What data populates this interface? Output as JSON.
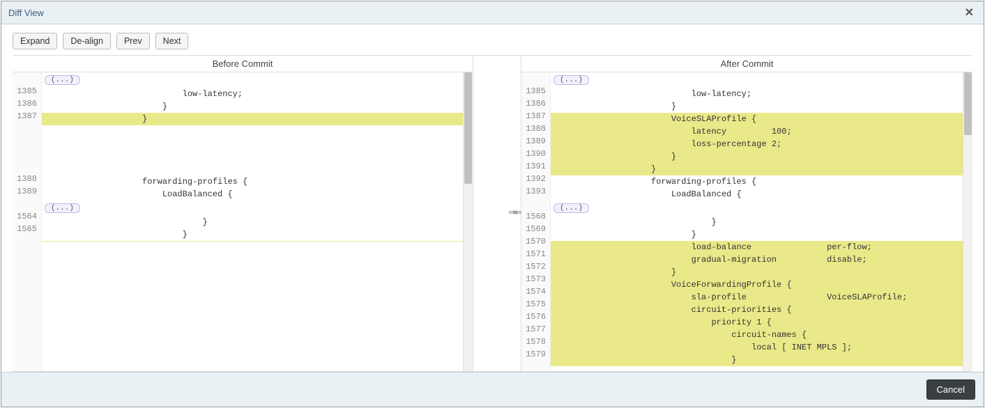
{
  "dialog": {
    "title": "Diff View",
    "close_label": "✕"
  },
  "toolbar": {
    "expand": "Expand",
    "dealign": "De-align",
    "prev": "Prev",
    "next": "Next"
  },
  "headers": {
    "before": "Before Commit",
    "after": "After Commit"
  },
  "fold_label": "(...)",
  "center": {
    "arrows": "⇒⇐"
  },
  "left": {
    "rows": [
      {
        "type": "fold"
      },
      {
        "ln": "1385",
        "text": "                            low-latency;"
      },
      {
        "ln": "1386",
        "text": "                        }"
      },
      {
        "ln": "1387",
        "text": "                    }",
        "class": "hl"
      },
      {
        "ln": "",
        "text": ""
      },
      {
        "ln": "",
        "text": ""
      },
      {
        "ln": "",
        "text": ""
      },
      {
        "ln": "",
        "text": ""
      },
      {
        "ln": "1388",
        "text": "                    forwarding-profiles {"
      },
      {
        "ln": "1389",
        "text": "                        LoadBalanced {"
      },
      {
        "type": "fold"
      },
      {
        "ln": "1564",
        "text": "                                }"
      },
      {
        "ln": "1565",
        "text": "                            }"
      },
      {
        "type": "sep"
      }
    ]
  },
  "right": {
    "rows": [
      {
        "type": "fold"
      },
      {
        "ln": "1385",
        "text": "                            low-latency;"
      },
      {
        "ln": "1386",
        "text": "                        }"
      },
      {
        "ln": "1387",
        "text": "                        VoiceSLAProfile {",
        "class": "hl"
      },
      {
        "ln": "1388",
        "text": "                            latency         100;",
        "class": "hl"
      },
      {
        "ln": "1389",
        "text": "                            loss-percentage 2;",
        "class": "hl"
      },
      {
        "ln": "1390",
        "text": "                        }",
        "class": "hl"
      },
      {
        "ln": "1391",
        "text": "                    }",
        "class": "hl"
      },
      {
        "ln": "1392",
        "text": "                    forwarding-profiles {"
      },
      {
        "ln": "1393",
        "text": "                        LoadBalanced {"
      },
      {
        "type": "fold"
      },
      {
        "ln": "1568",
        "text": "                                }"
      },
      {
        "ln": "1569",
        "text": "                            }"
      },
      {
        "ln": "1570",
        "text": "                            load-balance               per-flow;",
        "class": "hl"
      },
      {
        "ln": "1571",
        "text": "                            gradual-migration          disable;",
        "class": "hl"
      },
      {
        "ln": "1572",
        "text": "                        }",
        "class": "hl"
      },
      {
        "ln": "1573",
        "text": "                        VoiceForwardingProfile {",
        "class": "hl"
      },
      {
        "ln": "1574",
        "text": "                            sla-profile                VoiceSLAProfile;",
        "class": "hl"
      },
      {
        "ln": "1575",
        "text": "                            circuit-priorities {",
        "class": "hl"
      },
      {
        "ln": "1576",
        "text": "                                priority 1 {",
        "class": "hl"
      },
      {
        "ln": "1577",
        "text": "                                    circuit-names {",
        "class": "hl"
      },
      {
        "ln": "1578",
        "text": "                                        local [ INET MPLS ];",
        "class": "hl"
      },
      {
        "ln": "1579",
        "text": "                                    }",
        "class": "hl"
      }
    ]
  },
  "footer": {
    "cancel": "Cancel"
  }
}
